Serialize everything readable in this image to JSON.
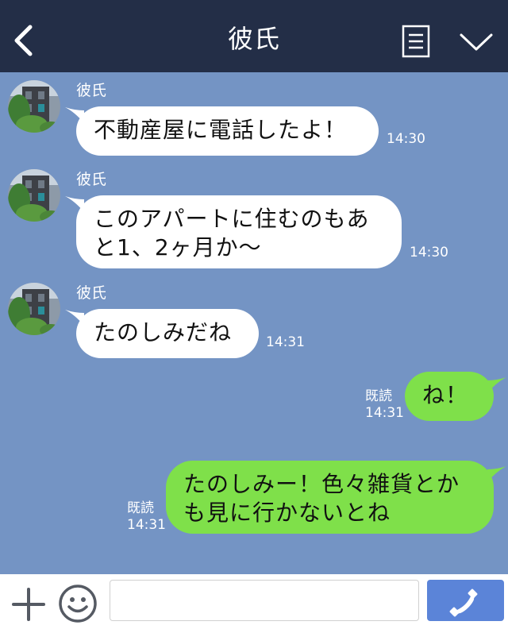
{
  "header": {
    "title": "彼氏"
  },
  "messages": [
    {
      "sender": "彼氏",
      "text": "不動産屋に電話したよ！",
      "time": "14:30"
    },
    {
      "sender": "彼氏",
      "text_lines": [
        "このアパートに住むのもあ",
        "と1、2ヶ月か〜"
      ],
      "time": "14:30"
    },
    {
      "sender": "彼氏",
      "text": "たのしみだね",
      "time": "14:31"
    },
    {
      "text": "ね！",
      "read": "既読",
      "time": "14:31"
    },
    {
      "text_lines": [
        "たのしみー！色々雑貨とか",
        "も見に行かないとね"
      ],
      "read": "既読",
      "time": "14:31"
    }
  ],
  "input": {
    "placeholder": ""
  },
  "colors": {
    "header_bg": "#232e47",
    "chat_bg": "#7494c4",
    "incoming_bubble": "#ffffff",
    "outgoing_bubble": "#7fe04a",
    "call_button": "#5b84d8"
  },
  "icons": [
    "back-icon",
    "menu-icon",
    "chevron-down-icon",
    "plus-icon",
    "emoji-icon",
    "phone-icon"
  ]
}
